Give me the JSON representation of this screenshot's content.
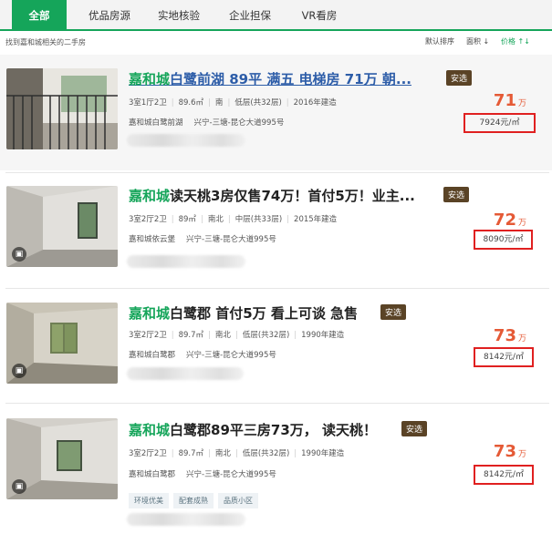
{
  "tabs": [
    {
      "label": "全部",
      "active": true
    },
    {
      "label": "优品房源"
    },
    {
      "label": "实地核验"
    },
    {
      "label": "企业担保"
    },
    {
      "label": "VR看房"
    }
  ],
  "filter": {
    "hint": "找到嘉和城相关的二手房",
    "sort_default": "默认排序",
    "sort_area": "面积 ↓",
    "sort_price": "价格 ↑↓"
  },
  "accent_color": "#15a55a",
  "listings": [
    {
      "title_kw": "嘉和城",
      "title_rest": "白鹭前湖 89平 满五 电梯房 71万 朝...",
      "badge": "安选",
      "meta": [
        "3室1厅2卫",
        "89.6㎡",
        "南",
        "低层(共32层)",
        "2016年建造"
      ],
      "community": "嘉和城白鹭前湖",
      "address": "兴宁-三塘-昆仑大道995号",
      "tags": [],
      "price": "71",
      "price_unit": "万",
      "unit_price": "7924元/㎡"
    },
    {
      "title_kw": "嘉和城",
      "title_rest": "读天桃3房仅售74万！首付5万！业主...",
      "badge": "安选",
      "meta": [
        "3室2厅2卫",
        "89㎡",
        "南北",
        "中层(共33层)",
        "2015年建造"
      ],
      "community": "嘉和城依云堡",
      "address": "兴宁-三塘-昆仑大道995号",
      "tags": [],
      "price": "72",
      "price_unit": "万",
      "unit_price": "8090元/㎡"
    },
    {
      "title_kw": "嘉和城",
      "title_rest": "白鹭郡 首付5万 看上可谈 急售",
      "badge": "安选",
      "meta": [
        "3室2厅2卫",
        "89.7㎡",
        "南北",
        "低层(共32层)",
        "1990年建造"
      ],
      "community": "嘉和城白鹭郡",
      "address": "兴宁-三塘-昆仑大道995号",
      "tags": [],
      "price": "73",
      "price_unit": "万",
      "unit_price": "8142元/㎡"
    },
    {
      "title_kw": "嘉和城",
      "title_rest": "白鹭郡89平三房73万， 读天桃！",
      "badge": "安选",
      "meta": [
        "3室2厅2卫",
        "89.7㎡",
        "南北",
        "低层(共32层)",
        "1990年建造"
      ],
      "community": "嘉和城白鹭郡",
      "address": "兴宁-三塘-昆仑大道995号",
      "tags": [
        "环境优美",
        "配套成熟",
        "品质小区"
      ],
      "price": "73",
      "price_unit": "万",
      "unit_price": "8142元/㎡"
    }
  ]
}
